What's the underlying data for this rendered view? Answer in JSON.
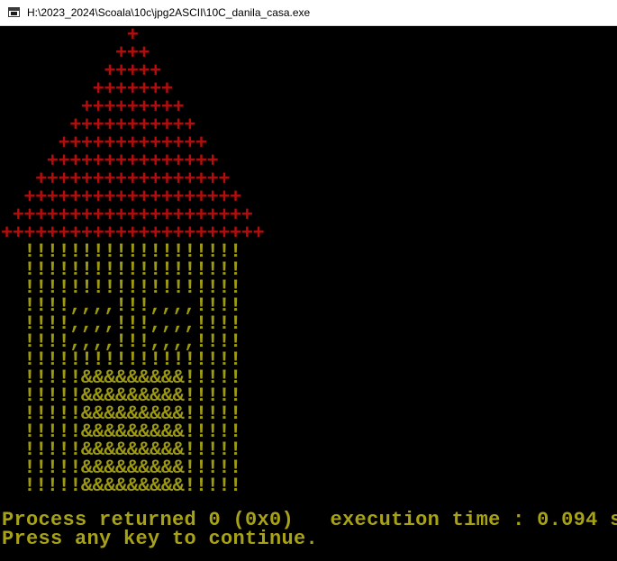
{
  "window": {
    "title": "H:\\2023_2024\\Scoala\\10c\\jpg2ASCII\\10C_danila_casa.exe",
    "icon": "console-app-icon"
  },
  "colors": {
    "background": "#000000",
    "roof": "#b20e0e",
    "walls": "#9e9a10",
    "status_text": "#a8a217",
    "titlebar": "#ffffff"
  },
  "ascii_art": {
    "roof": [
      "           +",
      "          +++",
      "         +++++",
      "        +++++++",
      "       +++++++++",
      "      +++++++++++",
      "     +++++++++++++",
      "    +++++++++++++++",
      "   +++++++++++++++++",
      "  +++++++++++++++++++",
      " +++++++++++++++++++++",
      "+++++++++++++++++++++++"
    ],
    "walls": [
      "  !!!!!!!!!!!!!!!!!!!",
      "  !!!!!!!!!!!!!!!!!!!",
      "  !!!!!!!!!!!!!!!!!!!",
      "  !!!!,,,,!!!,,,,!!!!",
      "  !!!!,,,,!!!,,,,!!!!",
      "  !!!!,,,,!!!,,,,!!!!",
      "  !!!!!!!!!!!!!!!!!!!",
      "  !!!!!&&&&&&&&&!!!!!",
      "  !!!!!&&&&&&&&&!!!!!",
      "  !!!!!&&&&&&&&&!!!!!",
      "  !!!!!&&&&&&&&&!!!!!",
      "  !!!!!&&&&&&&&&!!!!!",
      "  !!!!!&&&&&&&&&!!!!!",
      "  !!!!!&&&&&&&&&!!!!!"
    ]
  },
  "status": {
    "process_line": "Process returned 0 (0x0)   execution time : 0.094 s",
    "continue_line": "Press any key to continue."
  }
}
